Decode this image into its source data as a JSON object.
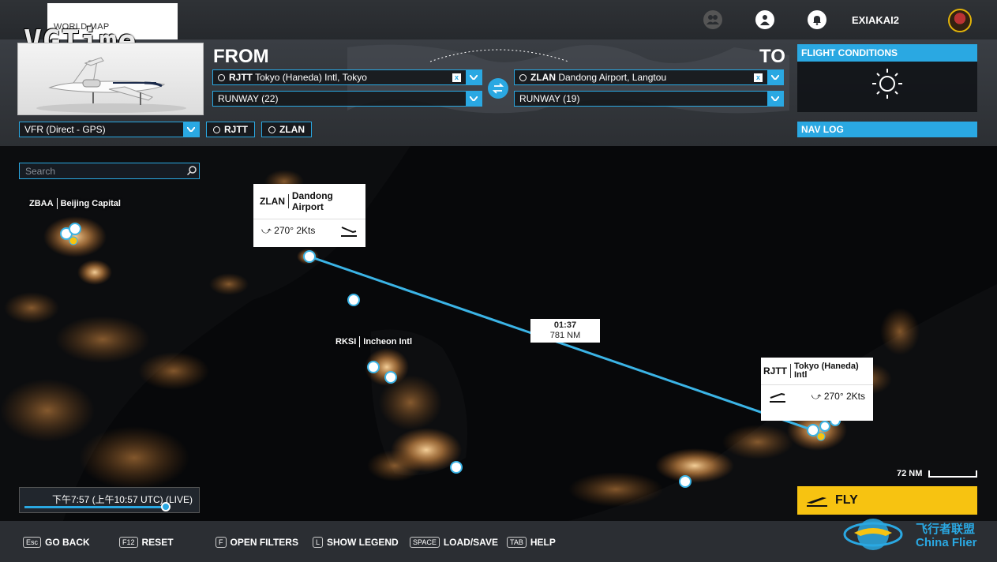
{
  "topbar": {
    "breadcrumb": "WORLD MAP",
    "watermark": "VGTime",
    "username": "EXIAKAI2"
  },
  "flight": {
    "from_label": "FROM",
    "to_label": "TO",
    "from_icao": "RJTT",
    "from_name": "Tokyo (Haneda) Intl, Tokyo",
    "to_icao": "ZLAN",
    "to_name": "Dandong Airport, Langtou",
    "from_runway": "RUNWAY (22)",
    "to_runway": "RUNWAY (19)",
    "clear_label": "x"
  },
  "flight_conditions": {
    "title": "FLIGHT CONDITIONS"
  },
  "nav_log": {
    "title": "NAV LOG"
  },
  "flight_plan": {
    "mode": "VFR (Direct - GPS)",
    "waypoints": [
      "RJTT",
      "ZLAN"
    ]
  },
  "map": {
    "search_placeholder": "Search",
    "labels": {
      "zbaa_code": "ZBAA",
      "zbaa_name": "Beijing Capital",
      "rksi_code": "RKSI",
      "rksi_name": "Incheon Intl"
    },
    "dest_card": {
      "code": "ZLAN",
      "name": "Dandong Airport",
      "wind": "270° 2Kts"
    },
    "origin_card": {
      "code": "RJTT",
      "name": "Tokyo (Haneda) Intl",
      "wind": "270° 2Kts"
    },
    "route": {
      "time": "01:37",
      "distance": "781 NM"
    },
    "scale": "72 NM",
    "time": {
      "text": "下午7:57 (上午10:57 UTC) (LIVE)",
      "progress": 0.95
    }
  },
  "fly_label": "FLY",
  "bottom": {
    "hints": [
      {
        "key": "Esc",
        "label": "GO BACK"
      },
      {
        "key": "F12",
        "label": "RESET"
      },
      {
        "key": "F",
        "label": "OPEN FILTERS"
      },
      {
        "key": "L",
        "label": "SHOW LEGEND"
      },
      {
        "key": "SPACE",
        "label": "LOAD/SAVE"
      },
      {
        "key": "TAB",
        "label": "HELP"
      }
    ]
  },
  "watermark2": {
    "cn": "飞行者联盟",
    "en": "China Flier"
  },
  "colors": {
    "accent": "#2aa8e2",
    "fly": "#f7c311",
    "city_lights": "#f0a050"
  }
}
